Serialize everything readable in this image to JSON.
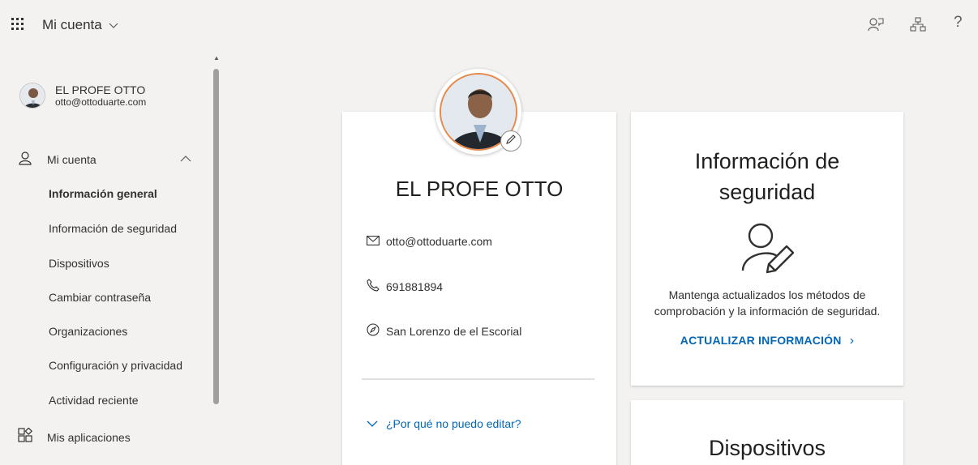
{
  "header": {
    "app_title": "Mi cuenta",
    "icons": [
      "waffle-icon",
      "chevron-down-icon",
      "feedback-icon",
      "organization-icon",
      "help-icon"
    ],
    "help_glyph": "?"
  },
  "sidebar": {
    "user": {
      "name": "EL PROFE OTTO",
      "email": "otto@ottoduarte.com"
    },
    "section_label": "Mi cuenta",
    "items": [
      {
        "label": "Información general",
        "active": true
      },
      {
        "label": "Información de seguridad",
        "active": false
      },
      {
        "label": "Dispositivos",
        "active": false
      },
      {
        "label": "Cambiar contraseña",
        "active": false
      },
      {
        "label": "Organizaciones",
        "active": false
      },
      {
        "label": "Configuración y privacidad",
        "active": false
      },
      {
        "label": "Actividad reciente",
        "active": false
      }
    ],
    "apps_label": "Mis aplicaciones"
  },
  "profile_card": {
    "name": "EL PROFE OTTO",
    "email": "otto@ottoduarte.com",
    "phone": "691881894",
    "location": "San Lorenzo de el Escorial",
    "why_link": "¿Por qué no puedo editar?"
  },
  "security_card": {
    "title_line1": "Información de",
    "title_line2": "seguridad",
    "desc_line1": "Mantenga actualizados los métodos de",
    "desc_line2": "comprobación y la información de seguridad.",
    "link": "ACTUALIZAR INFORMACIÓN",
    "link_chevron": "›"
  },
  "devices_card": {
    "title": "Dispositivos"
  },
  "colors": {
    "accent": "#0067b8",
    "background": "#f3f2f1",
    "avatar_ring": "#e8894a"
  }
}
